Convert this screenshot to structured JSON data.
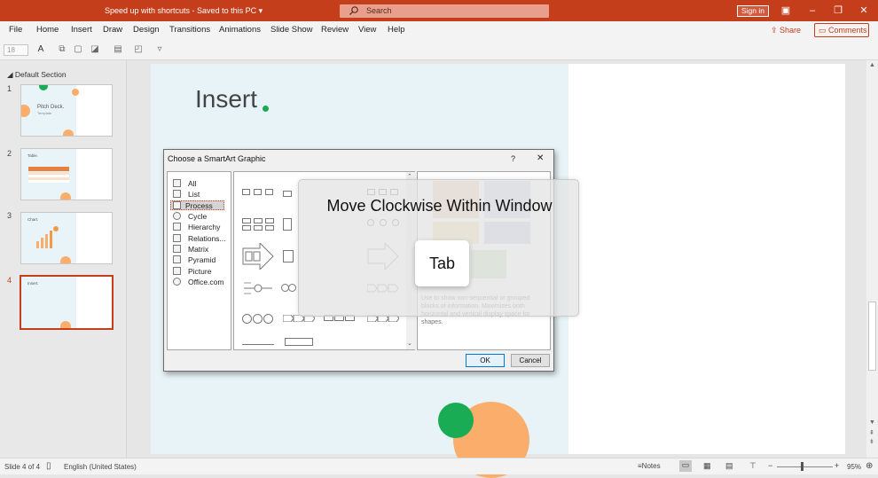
{
  "titlebar": {
    "title": "Speed up with shortcuts  -  Saved to this PC  ▾",
    "search_placeholder": "Search",
    "sign_in": "Sign in"
  },
  "menu": [
    "File",
    "Home",
    "Insert",
    "Draw",
    "Design",
    "Transitions",
    "Animations",
    "Slide Show",
    "Review",
    "View",
    "Help"
  ],
  "actions": {
    "share": "Share",
    "comments": "Comments"
  },
  "ribbon": {
    "font_size": "18"
  },
  "thumbnails": {
    "section": "Default Section",
    "slides": [
      {
        "num": "1",
        "caption": "Pitch Deck.",
        "sub": "Template"
      },
      {
        "num": "2",
        "caption": "Table."
      },
      {
        "num": "3",
        "caption": "Chart."
      },
      {
        "num": "4",
        "caption": "Insert."
      }
    ]
  },
  "slide": {
    "title": "Insert"
  },
  "dialog": {
    "title": "Choose a SmartArt Graphic",
    "help": "?",
    "close": "✕",
    "categories": [
      "All",
      "List",
      "Process",
      "Cycle",
      "Hierarchy",
      "Relations...",
      "Matrix",
      "Pyramid",
      "Picture",
      "Office.com"
    ],
    "selected_category": "Process",
    "description": "Use to show non-sequential or grouped blocks of information. Maximizes both horizontal and vertical display space for shapes.",
    "ok": "OK",
    "cancel": "Cancel"
  },
  "overlay": {
    "action": "Move Clockwise Within Window",
    "key": "Tab"
  },
  "status": {
    "slide": "Slide 4 of 4",
    "language": "English (United States)",
    "notes": "Notes",
    "zoom": "95%"
  },
  "colors": {
    "accent": "#c43e1c",
    "green": "#1aab55",
    "orange": "#fbae6b"
  }
}
